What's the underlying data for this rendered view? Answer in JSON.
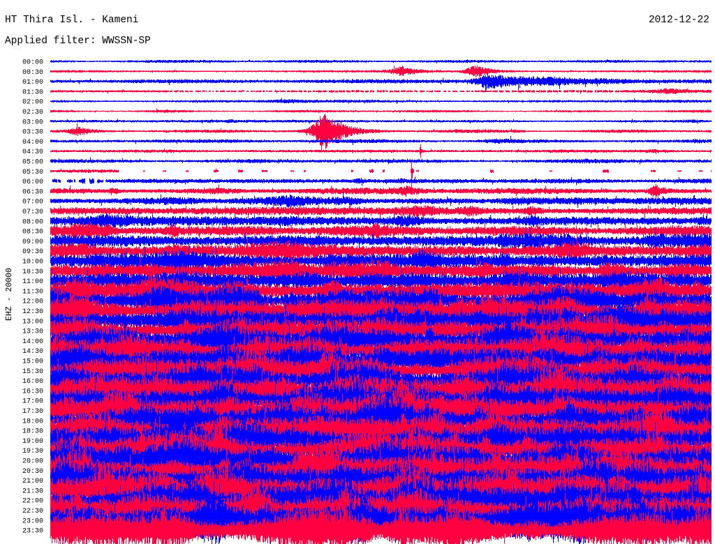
{
  "chart_data": {
    "type": "line",
    "title": "HT Thira Isl. - Kameni",
    "date": "2012-12-22",
    "filter": "Applied filter: WWSSN-SP",
    "ylabel": "EHZ - 20000",
    "xlim": [
      0,
      30
    ],
    "grid": false,
    "colors": [
      "#0000ff",
      "#ff0040"
    ],
    "rows": [
      {
        "time": "00:00",
        "relative_amplitude": 0.12
      },
      {
        "time": "00:30",
        "relative_amplitude": 0.1
      },
      {
        "time": "01:00",
        "relative_amplitude": 0.18
      },
      {
        "time": "01:30",
        "relative_amplitude": 0.12
      },
      {
        "time": "02:00",
        "relative_amplitude": 0.12
      },
      {
        "time": "02:30",
        "relative_amplitude": 0.1
      },
      {
        "time": "03:00",
        "relative_amplitude": 0.12
      },
      {
        "time": "03:30",
        "relative_amplitude": 0.13
      },
      {
        "time": "04:00",
        "relative_amplitude": 0.15
      },
      {
        "time": "04:30",
        "relative_amplitude": 0.13
      },
      {
        "time": "05:00",
        "relative_amplitude": 0.16
      },
      {
        "time": "05:30",
        "relative_amplitude": 0.13
      },
      {
        "time": "06:00",
        "relative_amplitude": 0.2
      },
      {
        "time": "06:30",
        "relative_amplitude": 0.25
      },
      {
        "time": "07:00",
        "relative_amplitude": 0.3
      },
      {
        "time": "07:30",
        "relative_amplitude": 0.35
      },
      {
        "time": "08:00",
        "relative_amplitude": 0.4
      },
      {
        "time": "08:30",
        "relative_amplitude": 0.45
      },
      {
        "time": "09:00",
        "relative_amplitude": 0.5
      },
      {
        "time": "09:30",
        "relative_amplitude": 0.55
      },
      {
        "time": "10:00",
        "relative_amplitude": 0.6
      },
      {
        "time": "10:30",
        "relative_amplitude": 0.65
      },
      {
        "time": "11:00",
        "relative_amplitude": 0.7
      },
      {
        "time": "11:30",
        "relative_amplitude": 0.8
      },
      {
        "time": "12:00",
        "relative_amplitude": 0.85
      },
      {
        "time": "12:30",
        "relative_amplitude": 0.9
      },
      {
        "time": "13:00",
        "relative_amplitude": 0.9
      },
      {
        "time": "13:30",
        "relative_amplitude": 0.95
      },
      {
        "time": "14:00",
        "relative_amplitude": 1.0
      },
      {
        "time": "14:30",
        "relative_amplitude": 1.0
      },
      {
        "time": "15:00",
        "relative_amplitude": 1.0
      },
      {
        "time": "15:30",
        "relative_amplitude": 1.05
      },
      {
        "time": "16:00",
        "relative_amplitude": 1.05
      },
      {
        "time": "16:30",
        "relative_amplitude": 1.05
      },
      {
        "time": "17:00",
        "relative_amplitude": 1.1
      },
      {
        "time": "17:30",
        "relative_amplitude": 1.1
      },
      {
        "time": "18:00",
        "relative_amplitude": 1.1
      },
      {
        "time": "18:30",
        "relative_amplitude": 1.1
      },
      {
        "time": "19:00",
        "relative_amplitude": 1.1
      },
      {
        "time": "19:30",
        "relative_amplitude": 1.15
      },
      {
        "time": "20:00",
        "relative_amplitude": 1.15
      },
      {
        "time": "20:30",
        "relative_amplitude": 1.15
      },
      {
        "time": "21:00",
        "relative_amplitude": 1.15
      },
      {
        "time": "21:30",
        "relative_amplitude": 1.2
      },
      {
        "time": "22:00",
        "relative_amplitude": 1.2
      },
      {
        "time": "22:30",
        "relative_amplitude": 1.2
      },
      {
        "time": "23:00",
        "relative_amplitude": 1.2
      },
      {
        "time": "23:30",
        "relative_amplitude": 1.25
      }
    ],
    "events": [
      {
        "row": "00:30",
        "minute": 16.0,
        "relative_amplitude": 0.4,
        "duration_min": 1.2
      },
      {
        "row": "00:30",
        "minute": 19.4,
        "relative_amplitude": 0.55,
        "duration_min": 1.2
      },
      {
        "row": "01:00",
        "minute": 19.9,
        "relative_amplitude": 0.6,
        "duration_min": 3.5
      },
      {
        "row": "03:30",
        "minute": 1.3,
        "relative_amplitude": 0.35,
        "duration_min": 1.0
      },
      {
        "row": "03:30",
        "minute": 12.5,
        "relative_amplitude": 1.7,
        "duration_min": 1.5
      },
      {
        "row": "04:30",
        "minute": 16.8,
        "relative_amplitude": 0.9,
        "duration_min": 0.05
      },
      {
        "row": "05:30",
        "minute": 16.4,
        "relative_amplitude": 1.5,
        "duration_min": 0.05
      },
      {
        "row": "06:30",
        "minute": 27.5,
        "relative_amplitude": 0.55,
        "duration_min": 0.6
      },
      {
        "row": "12:30",
        "minute": 17.7,
        "relative_amplitude": 1.6,
        "duration_min": 0.1
      },
      {
        "row": "14:00",
        "minute": 25.6,
        "relative_amplitude": 1.8,
        "duration_min": 0.1
      }
    ],
    "gaps": [
      {
        "row": "01:30",
        "from_minute": 5.4,
        "to_minute": 26.0,
        "coverage": 0.75
      },
      {
        "row": "05:30",
        "from_minute": 3.1,
        "to_minute": 30.0,
        "coverage": 0.12
      },
      {
        "row": "06:00",
        "from_minute": 0.0,
        "to_minute": 2.6,
        "coverage": 0.55
      }
    ]
  }
}
